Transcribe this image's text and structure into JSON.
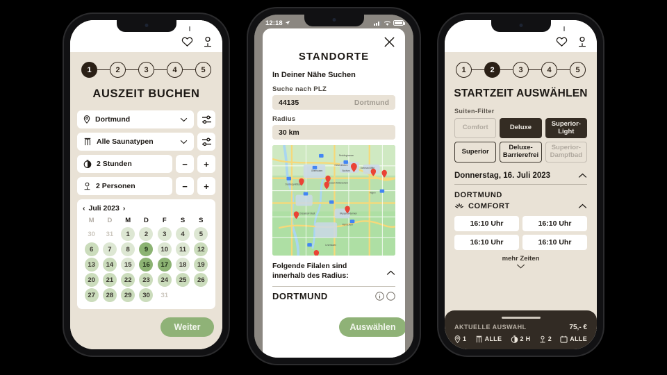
{
  "status_bar": {
    "time": "12:18",
    "icons": [
      "location-arrow-icon",
      "cellular-icon",
      "wifi-icon",
      "battery-icon"
    ]
  },
  "colors": {
    "background": "#000000",
    "screen_beige": "#e9e2d6",
    "dark_brown": "#2b2016",
    "accent_green": "#8fb277",
    "calendar_green_light": "#dde7d3",
    "calendar_green_mid": "#cbdcbc",
    "calendar_green_dark": "#8cb373",
    "bottom_bar": "#322b24"
  },
  "phone1": {
    "appbar": {
      "icons": [
        "heart-icon",
        "account-icon"
      ]
    },
    "steps": {
      "items": [
        "1",
        "2",
        "3",
        "4",
        "5"
      ],
      "active_index": 0
    },
    "title": "AUSZEIT BUCHEN",
    "fields": [
      {
        "icon": "location-pin-icon",
        "value": "Dortmund",
        "chevron": "chevron-down-icon",
        "filter_icon": "sliders-icon"
      },
      {
        "icon": "sauna-icon",
        "value": "Alle Saunatypen",
        "chevron": "chevron-down-icon",
        "filter_icon": "sliders-icon"
      }
    ],
    "steppers": [
      {
        "icon": "duration-icon",
        "value": "2 Stunden",
        "minus": "−",
        "plus": "+"
      },
      {
        "icon": "person-icon",
        "value": "2 Personen",
        "minus": "−",
        "plus": "+"
      }
    ],
    "calendar": {
      "prev": "‹",
      "month": "Juli 2023",
      "next": "›",
      "weekdays": [
        "M",
        "D",
        "M",
        "D",
        "F",
        "S",
        "S"
      ],
      "weeks": [
        [
          {
            "n": "30",
            "state": "off"
          },
          {
            "n": "31",
            "state": "off"
          },
          {
            "n": "1",
            "state": "l1"
          },
          {
            "n": "2",
            "state": "l1"
          },
          {
            "n": "3",
            "state": "l1"
          },
          {
            "n": "4",
            "state": "l1"
          },
          {
            "n": "5",
            "state": "l1"
          }
        ],
        [
          {
            "n": "6",
            "state": "l2"
          },
          {
            "n": "7",
            "state": "l1"
          },
          {
            "n": "8",
            "state": "l1"
          },
          {
            "n": "9",
            "state": "l3"
          },
          {
            "n": "10",
            "state": "l1"
          },
          {
            "n": "11",
            "state": "l1"
          },
          {
            "n": "12",
            "state": "l2"
          }
        ],
        [
          {
            "n": "13",
            "state": "l2"
          },
          {
            "n": "14",
            "state": "l2"
          },
          {
            "n": "15",
            "state": "l1"
          },
          {
            "n": "16",
            "state": "l3"
          },
          {
            "n": "17",
            "state": "l3"
          },
          {
            "n": "18",
            "state": "l1"
          },
          {
            "n": "19",
            "state": "l2"
          }
        ],
        [
          {
            "n": "20",
            "state": "l2"
          },
          {
            "n": "21",
            "state": "l2"
          },
          {
            "n": "22",
            "state": "l2"
          },
          {
            "n": "23",
            "state": "l2"
          },
          {
            "n": "24",
            "state": "l2"
          },
          {
            "n": "25",
            "state": "l2"
          },
          {
            "n": "26",
            "state": "l2"
          }
        ],
        [
          {
            "n": "27",
            "state": "l2"
          },
          {
            "n": "28",
            "state": "l2"
          },
          {
            "n": "29",
            "state": "l2"
          },
          {
            "n": "30",
            "state": "l2"
          },
          {
            "n": "31",
            "state": "off"
          },
          {
            "n": "",
            "state": "off"
          },
          {
            "n": "",
            "state": "off"
          }
        ]
      ]
    },
    "cta": "Weiter"
  },
  "phone2": {
    "close_icon": "close-icon",
    "title": "STANDORTE",
    "subtitle": "In Deiner Nähe Suchen",
    "plz_label": "Suche nach PLZ",
    "plz_value": "44135",
    "plz_city": "Dortmund",
    "radius_label": "Radius",
    "radius_value": "30 km",
    "map": {
      "name": "map-ruhr-area",
      "pin_count": 9
    },
    "footer_text_line1": "Folgende Filalen sind",
    "footer_text_line2": "innerhalb des Radius:",
    "collapse_icon": "chevron-up-icon",
    "branch": "DORTMUND",
    "branch_info_icon": "info-icon",
    "cta": "Auswählen"
  },
  "phone3": {
    "appbar": {
      "icons": [
        "heart-icon",
        "account-icon"
      ]
    },
    "steps": {
      "items": [
        "1",
        "2",
        "3",
        "4",
        "5"
      ],
      "active_index": 1
    },
    "title": "STARTZEIT AUSWÄHLEN",
    "filter_label": "Suiten-Filter",
    "chips": [
      {
        "label": "Comfort",
        "state": "dis"
      },
      {
        "label": "Deluxe",
        "state": "sel"
      },
      {
        "label": "Superior-\nLight",
        "state": "sel"
      },
      {
        "label": "Superior",
        "state": "on"
      },
      {
        "label": "Deluxe-\nBarrierefrei",
        "state": "on"
      },
      {
        "label": "Superior-\nDampfbad",
        "state": "dis"
      }
    ],
    "date": "Donnerstag, 16. Juli 2023",
    "date_chevron": "chevron-up-icon",
    "city": "DORTMUND",
    "suite_icon": "lotus-icon",
    "suite": "COMFORT",
    "suite_chevron": "chevron-up-icon",
    "slots": [
      "16:10 Uhr",
      "16:10 Uhr",
      "16:10 Uhr",
      "16:10 Uhr"
    ],
    "more": "mehr Zeiten",
    "more_icon": "chevron-down-icon",
    "bottom": {
      "label": "AKTUELLE AUSWAHL",
      "price": "75,- €",
      "items": [
        {
          "icon": "location-pin-icon",
          "value": "1"
        },
        {
          "icon": "sauna-icon",
          "value": "ALLE"
        },
        {
          "icon": "duration-icon",
          "value": "2 H"
        },
        {
          "icon": "person-icon",
          "value": "2"
        },
        {
          "icon": "calendar-icon",
          "value": "ALLE"
        }
      ]
    }
  }
}
